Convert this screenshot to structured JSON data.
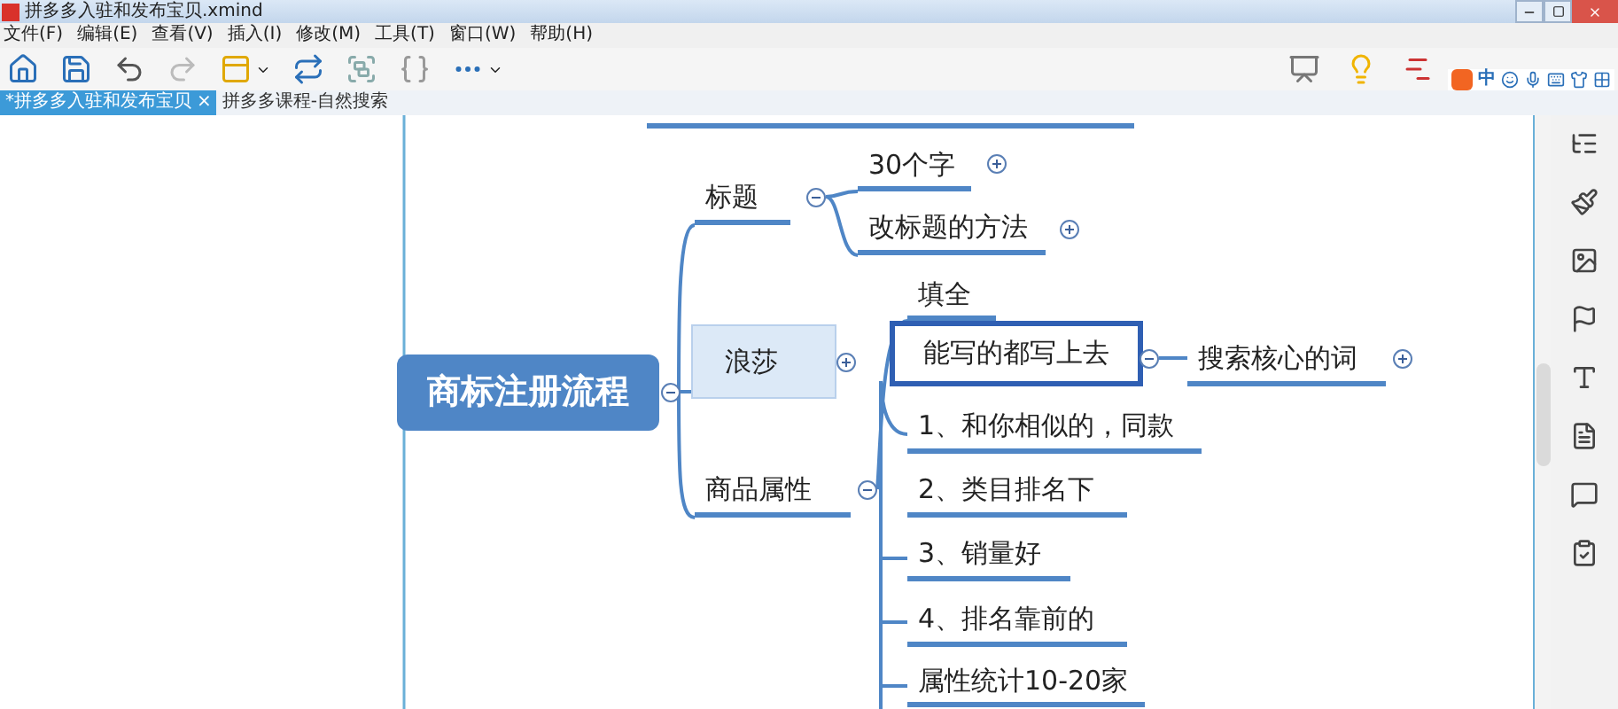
{
  "window": {
    "title": "拼多多入驻和发布宝贝.xmind"
  },
  "menu": [
    "文件(F)",
    "编辑(E)",
    "查看(V)",
    "插入(I)",
    "修改(M)",
    "工具(T)",
    "窗口(W)",
    "帮助(H)"
  ],
  "tabs": [
    {
      "label": "*拼多多入驻和发布宝贝",
      "selected": true,
      "close": "×"
    },
    {
      "label": "拼多多课程-自然搜索",
      "selected": false
    }
  ],
  "ime_bar": {
    "mode": "中"
  },
  "map": {
    "text": "商标注册流程",
    "selected": false,
    "highlighted": false,
    "expanded": true,
    "children": [
      {
        "text": "标题",
        "selected": false,
        "highlighted": false,
        "expanded": true,
        "children": [
          {
            "text": "30个字",
            "selected": false,
            "highlighted": false,
            "expanded": false
          },
          {
            "text": "改标题的方法",
            "selected": false,
            "highlighted": false,
            "expanded": false
          }
        ]
      },
      {
        "text": "浪莎",
        "selected": false,
        "highlighted": true,
        "expanded": false
      },
      {
        "text": "商品属性",
        "selected": false,
        "highlighted": false,
        "expanded": true,
        "children": [
          {
            "text": "填全",
            "selected": false,
            "highlighted": false
          },
          {
            "text": "能写的都写上去",
            "selected": true,
            "highlighted": false,
            "expanded": true,
            "children": [
              {
                "text": "搜索核心的词",
                "selected": false,
                "highlighted": false,
                "expanded": false
              }
            ]
          },
          {
            "text": "1、和你相似的，同款",
            "selected": false,
            "highlighted": false
          },
          {
            "text": "2、类目排名下",
            "selected": false,
            "highlighted": false
          },
          {
            "text": "3、销量好",
            "selected": false,
            "highlighted": false
          },
          {
            "text": "4、排名靠前的",
            "selected": false,
            "highlighted": false
          },
          {
            "text": "属性统计10-20家",
            "selected": false,
            "highlighted": false
          }
        ]
      }
    ]
  }
}
